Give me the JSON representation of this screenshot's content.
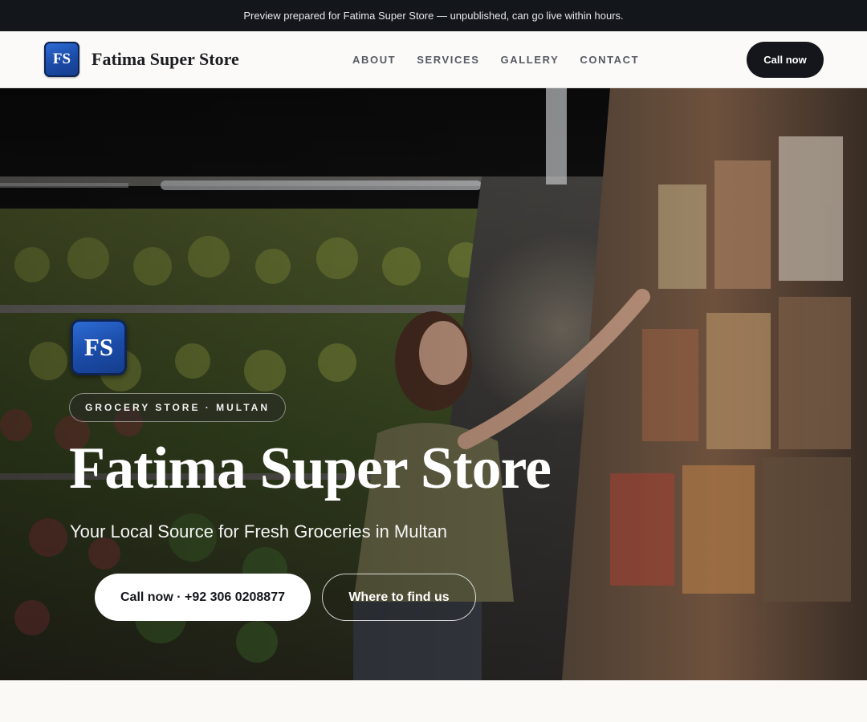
{
  "topbar": {
    "text": "Preview prepared for Fatima Super Store — unpublished, can go live within hours."
  },
  "header": {
    "logo_initials": "FS",
    "brand_name": "Fatima Super Store",
    "nav": [
      {
        "label": "ABOUT"
      },
      {
        "label": "SERVICES"
      },
      {
        "label": "GALLERY"
      },
      {
        "label": "CONTACT"
      }
    ],
    "cta_label": "Call now"
  },
  "hero": {
    "logo_initials": "FS",
    "badge": "GROCERY STORE · MULTAN",
    "title": "Fatima Super Store",
    "subtitle": "Your Local Source for Fresh Groceries in Multan",
    "primary_button": "Call now · +92 306 0208877",
    "secondary_button": "Where to find us"
  },
  "colors": {
    "topbar_bg": "#13161b",
    "brand_blue": "#1a4aa6",
    "dark_button": "#14161b",
    "page_bg": "#faf9f6"
  },
  "icons": {
    "logo": "fs-monogram-icon"
  }
}
